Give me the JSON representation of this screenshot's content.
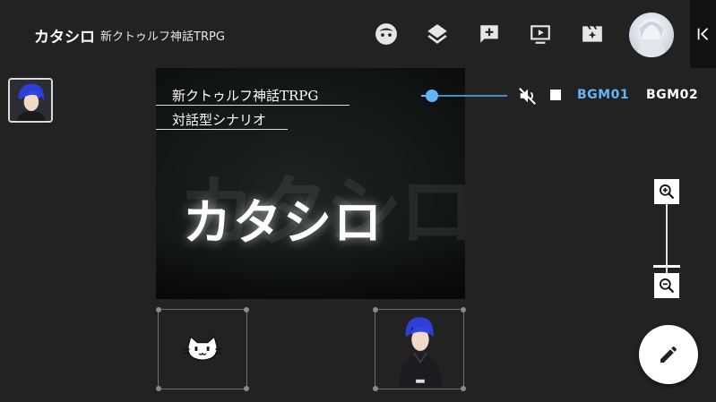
{
  "header": {
    "title": "カタシロ",
    "subtitle": "新クトゥルフ神話TRPG",
    "icons": [
      "face-icon",
      "layers-icon",
      "add-comment-icon",
      "play-screen-icon",
      "movie-sparkle-icon"
    ],
    "avatar": "user-avatar",
    "collapse_icon": "collapse-left-icon"
  },
  "stage": {
    "line1": "新クトゥルフ神話TRPG",
    "line2": "対話型シナリオ",
    "title": "カタシロ",
    "ghost_text": "カタシロ"
  },
  "bgm": {
    "volume": 0.12,
    "tabs": [
      {
        "label": "BGM01",
        "active": true
      },
      {
        "label": "BGM02",
        "active": false
      }
    ],
    "colors": {
      "active": "#64b5f6",
      "inactive": "#ffffff",
      "slider": "#64b5f6"
    }
  },
  "zoom": {
    "in_icon": "zoom-in-icon",
    "out_icon": "zoom-out-icon"
  },
  "slots": [
    {
      "content": "cat-icon"
    },
    {
      "content": "character-portrait"
    }
  ],
  "fab": {
    "icon": "pencil-icon"
  }
}
